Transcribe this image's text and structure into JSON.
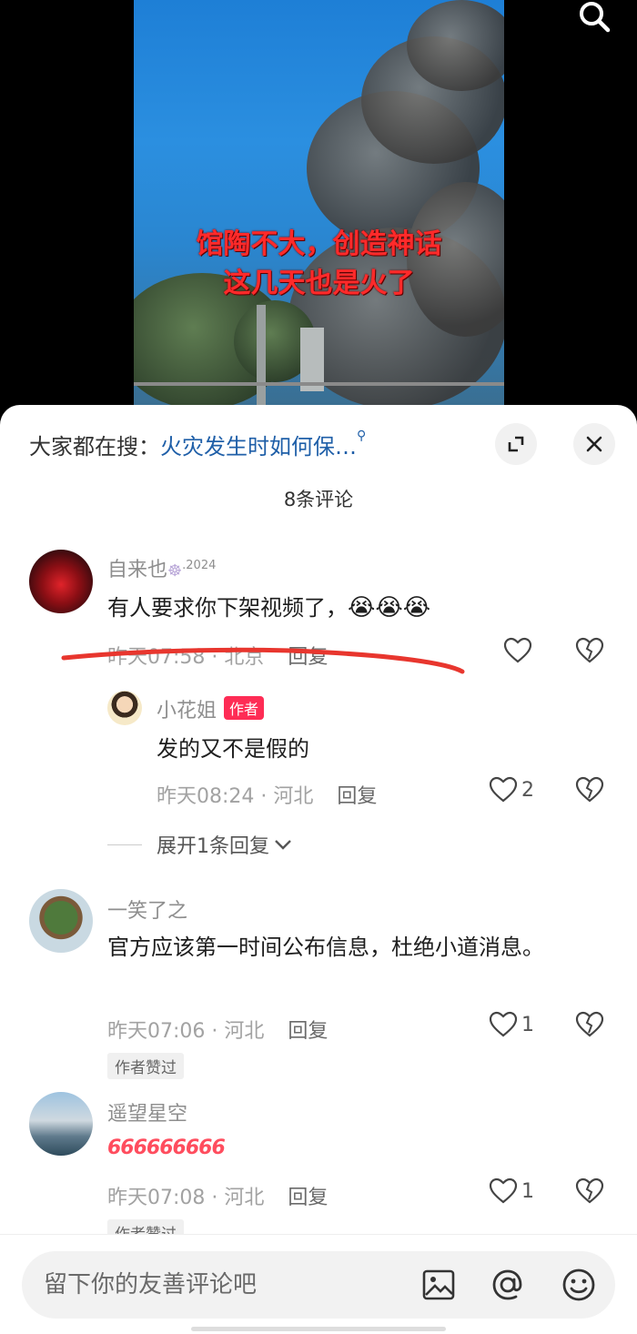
{
  "video": {
    "caption_line1": "馆陶不大，创造神话",
    "caption_line2": "这几天也是火了"
  },
  "sheet": {
    "hot_search_prefix": "大家都在搜：",
    "hot_search_query": "火灾发生时如何保…",
    "comment_count": "8条评论"
  },
  "comments": [
    {
      "username": "自来也",
      "username_suffix": ".2024",
      "text": "有人要求你下架视频了，",
      "emoji": "😭😭😭",
      "time": "昨天07:58",
      "location": "北京",
      "reply_label": "回复",
      "likes": ""
    },
    {
      "username": "小花姐",
      "author_tag": "作者",
      "text": "发的又不是假的",
      "time": "昨天08:24",
      "location": "河北",
      "reply_label": "回复",
      "likes": "2"
    },
    {
      "username": "一笑了之",
      "text": "官方应该第一时间公布信息，杜绝小道消息。",
      "time": "昨天07:06",
      "location": "河北",
      "reply_label": "回复",
      "likes": "1",
      "badge": "作者赞过"
    },
    {
      "username": "遥望星空",
      "text": "666666666",
      "time": "昨天07:08",
      "location": "河北",
      "reply_label": "回复",
      "likes": "1",
      "badge": "作者赞过"
    }
  ],
  "expand_replies": "展开1条回复",
  "input": {
    "placeholder": "留下你的友善评论吧"
  },
  "colors": {
    "caption": "#ff2a2a",
    "author_tag": "#fe2c55",
    "query_link": "#1f5fa8",
    "annotation_line": "#e8362e",
    "emoji_666": "#ff4d5e"
  }
}
